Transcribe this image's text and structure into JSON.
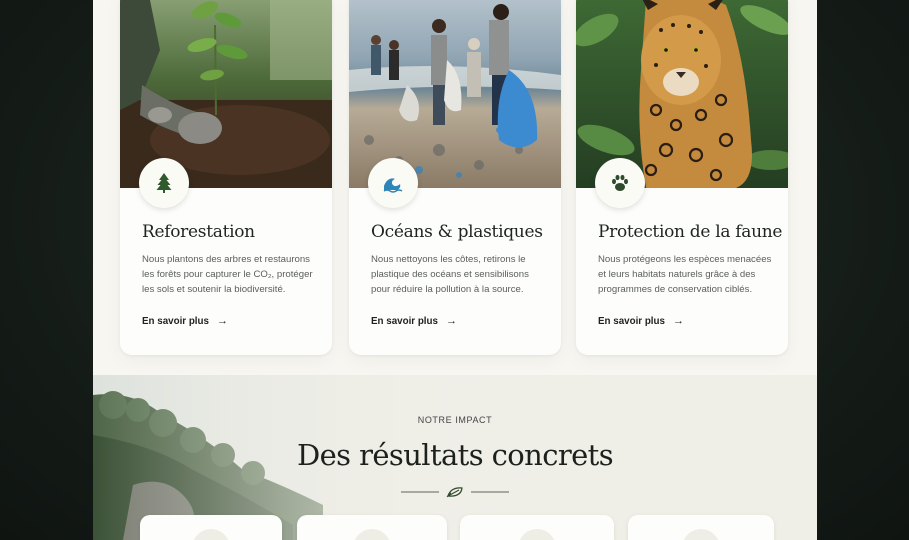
{
  "cards": [
    {
      "icon": "tree-icon",
      "title": "Reforestation",
      "description": "Nous plantons des arbres et restaurons les forêts pour capturer le CO₂, protéger les sols et soutenir la biodiversité.",
      "link": "En savoir plus",
      "arrow": "→"
    },
    {
      "icon": "wave-icon",
      "title": "Océans & plastiques",
      "description": "Nous nettoyons les côtes, retirons le plastique des océans et sensibilisons pour réduire la pollution à la source.",
      "link": "En savoir plus",
      "arrow": "→"
    },
    {
      "icon": "paw-icon",
      "title": "Protection de la faune",
      "description": "Nous protégeons les espèces menacées et leurs habitats naturels grâce à des programmes de conservation ciblés.",
      "link": "En savoir plus",
      "arrow": "→"
    }
  ],
  "impact": {
    "eyebrow": "NOTRE IMPACT",
    "title": "Des résultats concrets",
    "divider_icon": "leaf-icon"
  },
  "colors": {
    "accent_green": "#2f5a2c",
    "ocean_blue": "#2e86b8",
    "page_bg": "#f7f6f1"
  }
}
